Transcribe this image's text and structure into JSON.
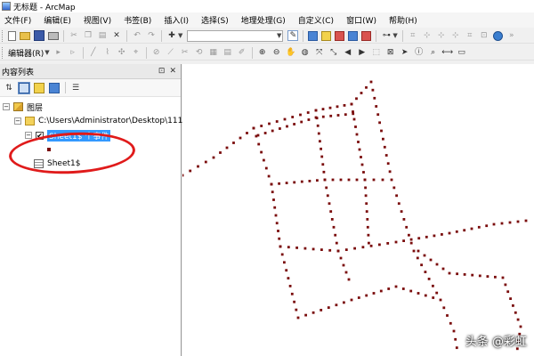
{
  "window": {
    "title": "无标题 - ArcMap"
  },
  "menubar": {
    "items": [
      {
        "label": "文件(F)"
      },
      {
        "label": "编辑(E)"
      },
      {
        "label": "视图(V)"
      },
      {
        "label": "书签(B)"
      },
      {
        "label": "插入(I)"
      },
      {
        "label": "选择(S)"
      },
      {
        "label": "地理处理(G)"
      },
      {
        "label": "自定义(C)"
      },
      {
        "label": "窗口(W)"
      },
      {
        "label": "帮助(H)"
      }
    ]
  },
  "toolbar1": {
    "scale_value": ""
  },
  "toolbar2": {
    "editor_label": "编辑器(R)"
  },
  "toc": {
    "title": "内容列表",
    "pin_icon": "pin-icon",
    "close_icon": "close-icon",
    "tree": {
      "root_label": "图层",
      "folder_label": "C:\\Users\\Administrator\\Desktop\\111\\",
      "layer_label": "Sheet1$ 个事件",
      "layer_checked": true,
      "table_label": "Sheet1$"
    }
  },
  "map": {
    "point_color": "#7a0c0c",
    "watermark": "头条 @彩虹"
  },
  "colors": {
    "selection": "#3399ff",
    "annotation": "#e01b1b"
  }
}
